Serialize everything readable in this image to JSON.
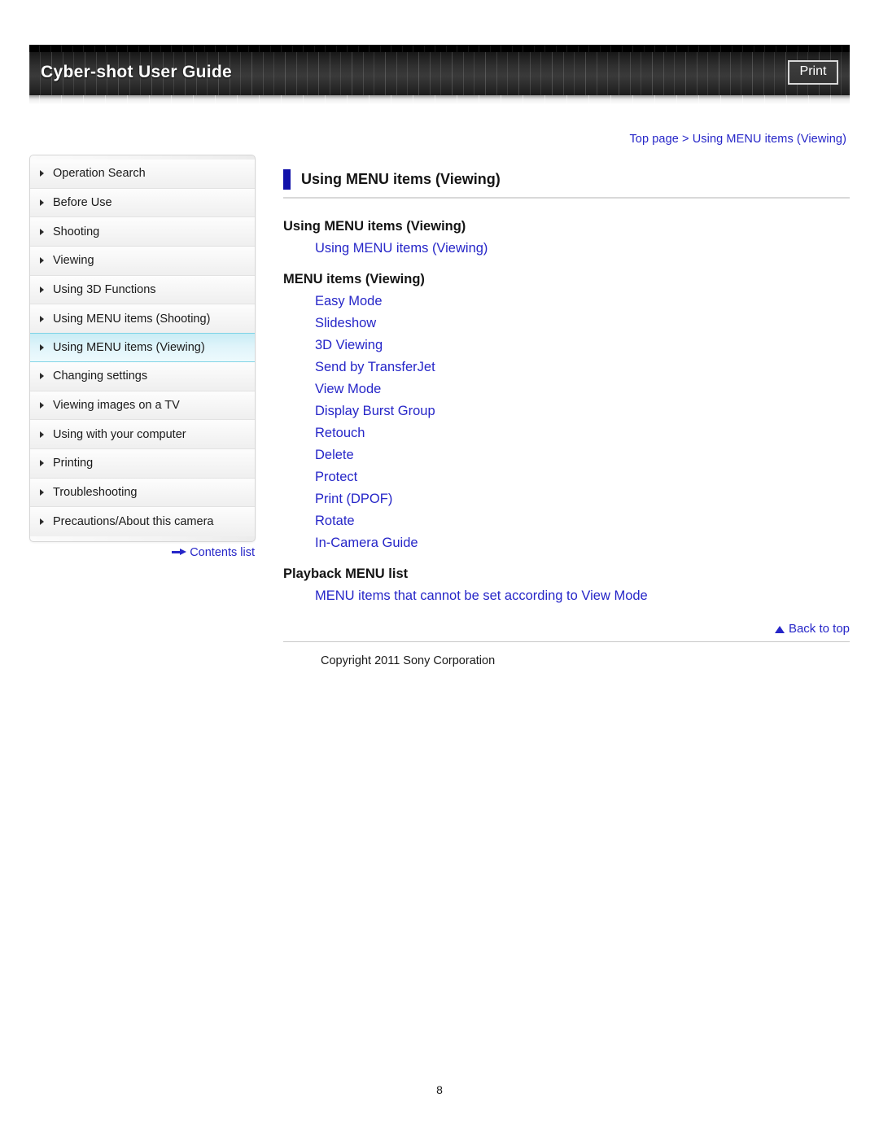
{
  "banner": {
    "title": "Cyber-shot User Guide",
    "print_label": "Print"
  },
  "breadcrumb": {
    "text": "Top page > Using MENU items (Viewing)"
  },
  "sidebar": {
    "items": [
      {
        "label": "Operation Search",
        "active": false
      },
      {
        "label": "Before Use",
        "active": false
      },
      {
        "label": "Shooting",
        "active": false
      },
      {
        "label": "Viewing",
        "active": false
      },
      {
        "label": "Using 3D Functions",
        "active": false
      },
      {
        "label": "Using MENU items (Shooting)",
        "active": false
      },
      {
        "label": "Using MENU items (Viewing)",
        "active": true
      },
      {
        "label": "Changing settings",
        "active": false
      },
      {
        "label": "Viewing images on a TV",
        "active": false
      },
      {
        "label": "Using with your computer",
        "active": false
      },
      {
        "label": "Printing",
        "active": false
      },
      {
        "label": "Troubleshooting",
        "active": false
      },
      {
        "label": "Precautions/About this camera",
        "active": false
      }
    ],
    "contents_list_label": "Contents list"
  },
  "main": {
    "page_title": "Using MENU items (Viewing)",
    "sections": [
      {
        "heading": "Using MENU items (Viewing)",
        "links": [
          "Using MENU items (Viewing)"
        ]
      },
      {
        "heading": "MENU items (Viewing)",
        "links": [
          "Easy Mode",
          "Slideshow",
          "3D Viewing",
          "Send by TransferJet",
          "View Mode",
          "Display Burst Group",
          "Retouch",
          "Delete",
          "Protect",
          "Print (DPOF)",
          "Rotate",
          "In-Camera Guide"
        ]
      },
      {
        "heading": "Playback MENU list",
        "links": [
          "MENU items that cannot be set according to View Mode"
        ]
      }
    ],
    "back_to_top_label": "Back to top",
    "copyright": "Copyright 2011 Sony Corporation"
  },
  "footer": {
    "page_number": "8"
  },
  "colors": {
    "link": "#2626c8",
    "accent_bar": "#1111aa",
    "active_nav": "#c8ecf5"
  }
}
